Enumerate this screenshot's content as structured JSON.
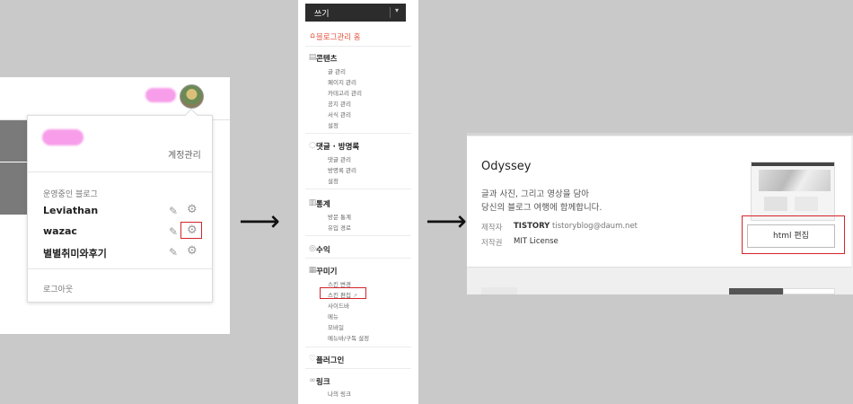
{
  "panel1": {
    "account_manage": "계정관리",
    "section_label": "운영중인 블로그",
    "blogs": [
      {
        "name": "Leviathan"
      },
      {
        "name": "wazac"
      },
      {
        "name": "별별취미와후기"
      }
    ],
    "logout": "로그아웃",
    "icons": {
      "edit": "pencil-icon",
      "settings": "gear-icon"
    }
  },
  "arrow": "⟶",
  "panel2": {
    "top_label": "쓰기",
    "home": "블로그관리 홈",
    "sections": [
      {
        "title": "콘텐츠",
        "icon": "document-icon",
        "items": [
          "글 관리",
          "페이지 관리",
          "카테고리 관리",
          "공지 관리",
          "서식 관리",
          "설정"
        ]
      },
      {
        "title": "댓글 · 방명록",
        "icon": "comment-icon",
        "items": [
          "댓글 관리",
          "방명록 관리",
          "설정"
        ]
      },
      {
        "title": "통계",
        "icon": "chart-icon",
        "items": [
          "방문 통계",
          "유입 경로"
        ]
      },
      {
        "title": "수익",
        "icon": "coin-icon",
        "items": []
      },
      {
        "title": "꾸미기",
        "icon": "layout-icon",
        "items": [
          "스킨 변경",
          "스킨 편집",
          "사이드바",
          "메뉴",
          "모바일",
          "메뉴바/구독 설정"
        ]
      },
      {
        "title": "플러그인",
        "icon": "plugin-icon",
        "items": []
      },
      {
        "title": "링크",
        "icon": "link-icon",
        "items": [
          "나의 링크"
        ]
      }
    ]
  },
  "panel3": {
    "skin_name": "Odyssey",
    "desc_line1": "글과 사진, 그리고 영상을 담아",
    "desc_line2": "당신의 블로그 여행에 함께합니다.",
    "maker_label": "제작자",
    "maker_brand": "TISTORY",
    "maker_email": "tistoryblog@daum.net",
    "license_label": "저작권",
    "license": "MIT License",
    "html_edit_button": "html 편집"
  },
  "colors": {
    "highlight": "#d4242b",
    "accent": "#e5533f",
    "topbar": "#2c2c2c"
  }
}
